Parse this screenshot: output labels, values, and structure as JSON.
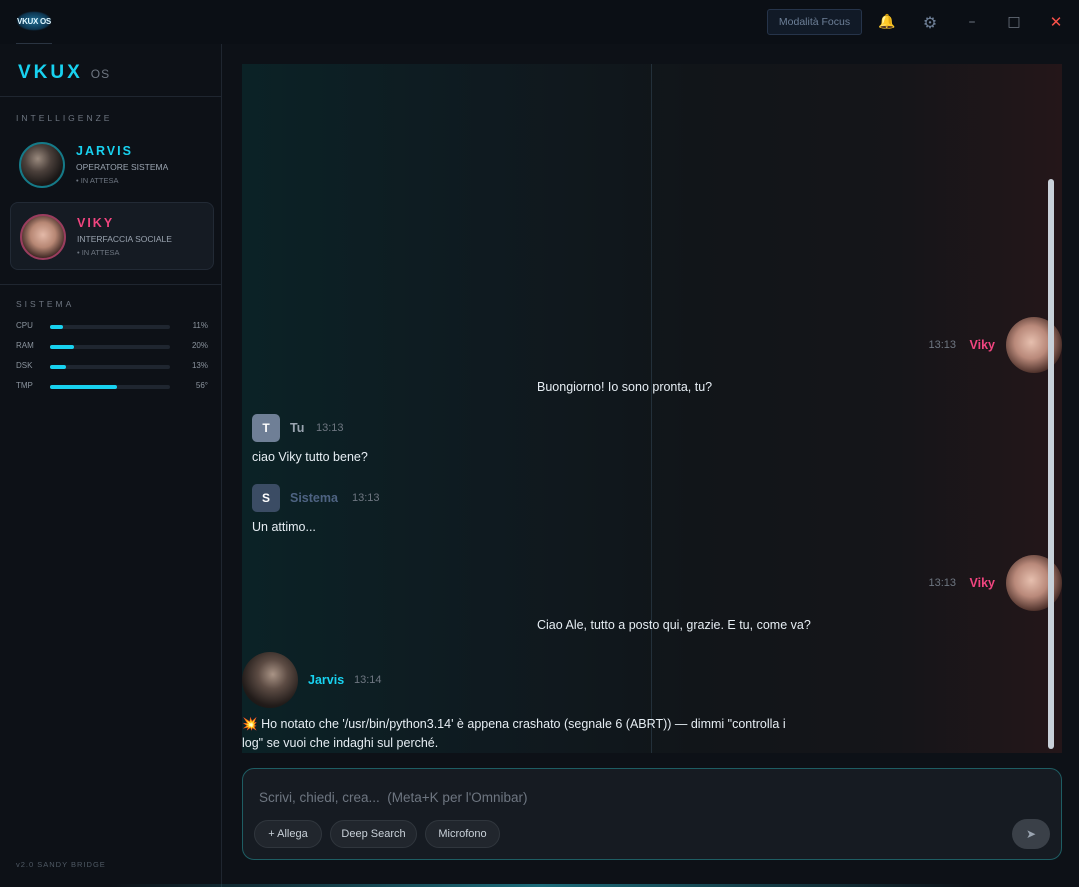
{
  "titlebar": {
    "logo_text": "VKUX OS",
    "focus_label": "Modalità Focus",
    "bell_icon": "🔔",
    "gear_icon": "⚙",
    "minimize_icon": "–",
    "maximize_icon": "□",
    "close_icon": "✕"
  },
  "sidebar": {
    "brand": "VKUX",
    "brand_os": "OS",
    "agents_title": "INTELLIGENZE",
    "agents": [
      {
        "name": "JARVIS",
        "role": "OPERATORE SISTEMA",
        "status": "• IN ATTESA",
        "color": "#18d2f0"
      },
      {
        "name": "VIKY",
        "role": "INTERFACCIA SOCIALE",
        "status": "• IN ATTESA",
        "color": "#f0457f"
      }
    ],
    "system_title": "SISTEMA",
    "metrics": [
      {
        "label": "CPU",
        "value": "11%",
        "fraction": 0.11
      },
      {
        "label": "RAM",
        "value": "20%",
        "fraction": 0.2
      },
      {
        "label": "DSK",
        "value": "13%",
        "fraction": 0.13
      },
      {
        "label": "TMP",
        "value": "56°",
        "fraction": 0.56
      }
    ],
    "version": "v2.0 SANDY BRIDGE"
  },
  "chat": {
    "messages": [
      {
        "sender": "Viky",
        "time": "13:13",
        "text": "Buongiorno! Io sono pronta, tu?"
      },
      {
        "sender": "Tu",
        "badge": "T",
        "time": "13:13",
        "text": "ciao Viky tutto bene?"
      },
      {
        "sender": "Sistema",
        "badge": "S",
        "time": "13:13",
        "text": "Un attimo..."
      },
      {
        "sender": "Viky",
        "time": "13:13",
        "text": "Ciao Ale, tutto a posto qui, grazie. E tu, come va?"
      },
      {
        "sender": "Jarvis",
        "time": "13:14",
        "icon": "💥",
        "text": "Ho notato che '/usr/bin/python3.14' è appena crashato (segnale 6 (ABRT)) — dimmi \"controlla i log\" se vuoi che indaghi sul perché."
      }
    ]
  },
  "composer": {
    "placeholder": "Scrivi, chiedi, crea...  (Meta+K per l'Omnibar)",
    "attach_label": "+ Allega",
    "deep_search_label": "Deep Search",
    "mic_label": "Microfono",
    "send_icon": "➤"
  },
  "colors": {
    "accent": "#18d2f0",
    "viky": "#f0457f",
    "system": "#3b4c64"
  }
}
